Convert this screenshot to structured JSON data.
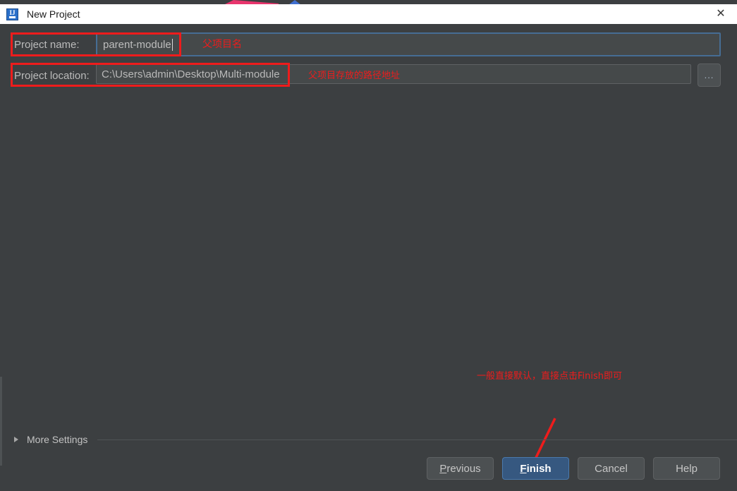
{
  "window": {
    "title": "New Project",
    "app_icon": "intellij-idea-icon",
    "close_icon": "✕"
  },
  "form": {
    "name_row": {
      "label": "Project name:",
      "value": "parent-module",
      "placeholder": "Project name"
    },
    "location_row": {
      "label": "Project location:",
      "value": "C:\\Users\\admin\\Desktop\\Multi-module",
      "placeholder": "Project location",
      "browse_label": "..."
    }
  },
  "annotations": {
    "name_note": "父项目名",
    "location_note": "父项目存放的路径地址",
    "finish_note": "一般直接默认，直接点击Finish即可",
    "arrow": "red-down-left-arrow",
    "color": "#ee1c1c"
  },
  "more_settings": {
    "label": "More Settings",
    "expanded": false,
    "chevron": "triangle-right"
  },
  "footer": {
    "previous": {
      "mnemonic": "P",
      "rest": "revious"
    },
    "finish": {
      "mnemonic": "F",
      "rest": "inish"
    },
    "cancel": "Cancel",
    "help": "Help"
  },
  "colors": {
    "dialog_background": "#3c3f41",
    "titlebar_background": "#ffffff",
    "field_background": "#45494a",
    "focus_border": "#466d94",
    "default_button": "#365880",
    "annotation_red": "#ee1c1c"
  }
}
